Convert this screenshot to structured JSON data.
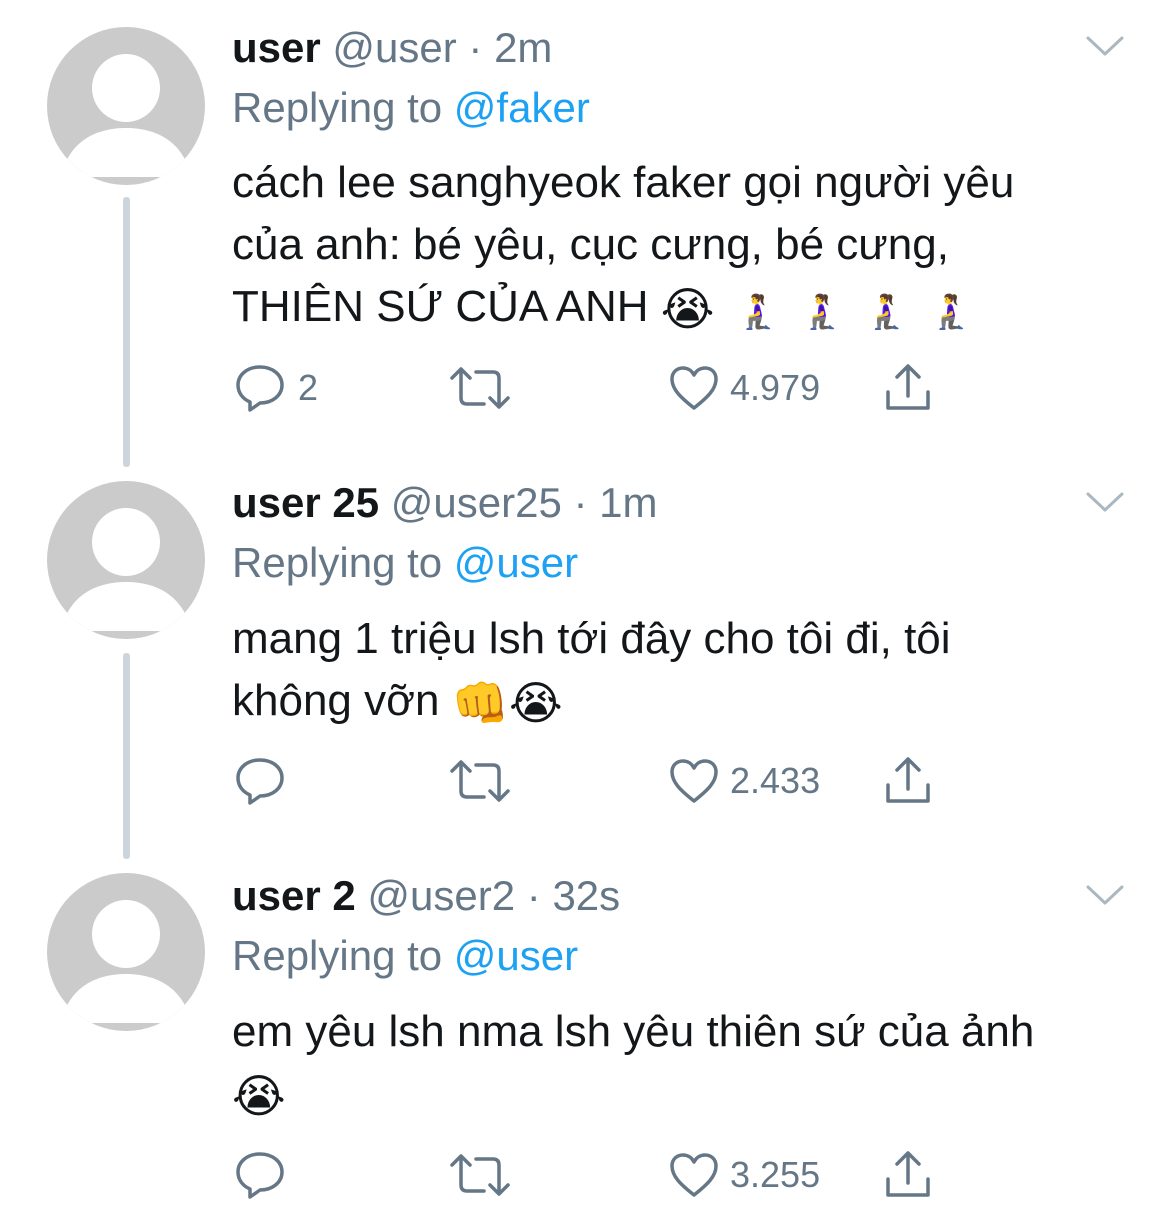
{
  "tweets": [
    {
      "name": "user",
      "handle": "@user",
      "time": "2m",
      "replying_prefix": "Replying to",
      "replying_to": "@faker",
      "text_lines": [
        "cách lee sanghyeok faker gọi người yêu",
        "của anh: bé yêu, cục cưng, bé cưng,",
        "THIÊN SỨ CỦA ANH"
      ],
      "line3_emoji": "😭",
      "line3_emoji_small": [
        "🧎‍♀️",
        "🧎‍♀️",
        "🧎‍♀️",
        "🧎‍♀️"
      ],
      "reply_count": "2",
      "like_count": "4.979"
    },
    {
      "name": "user 25",
      "handle": "@user25",
      "time": "1m",
      "replying_prefix": "Replying to",
      "replying_to": "@user",
      "text_lines": [
        "mang 1 triệu lsh tới đây cho tôi đi, tôi",
        "không vỡn"
      ],
      "line2_emoji": [
        "👊",
        "😭"
      ],
      "reply_count": "",
      "like_count": "2.433"
    },
    {
      "name": "user 2",
      "handle": "@user2",
      "time": "32s",
      "replying_prefix": "Replying to",
      "replying_to": "@user",
      "text_lines": [
        "em yêu lsh nma lsh yêu thiên sứ của ảnh"
      ],
      "line2_emoji": [
        "😭"
      ],
      "reply_count": "",
      "like_count": "3.255"
    }
  ],
  "icons": {
    "reply": "reply-icon",
    "retweet": "retweet-icon",
    "like": "like-icon",
    "share": "share-icon",
    "more": "chevron-down-icon",
    "avatar": "default-avatar-icon"
  },
  "colors": {
    "text": "#14171a",
    "secondary": "#657786",
    "link": "#1da1f2",
    "avatar_bg": "#cbcbcb",
    "thread_line": "#cdd5dc"
  }
}
